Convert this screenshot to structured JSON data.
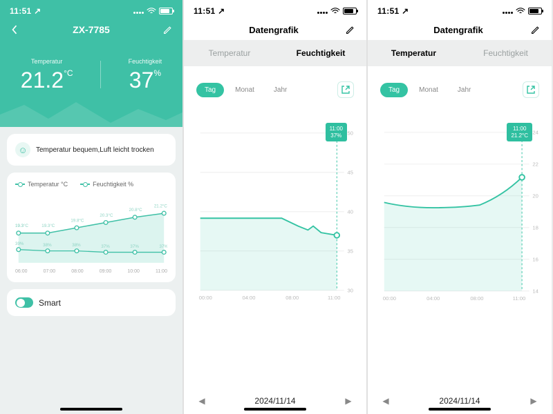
{
  "status": {
    "time": "11:51",
    "arrow": "↗"
  },
  "colors": {
    "accent": "#3fc0a6"
  },
  "screen1": {
    "title": "ZX-7785",
    "temp": {
      "label": "Temperatur",
      "value": "21.2",
      "unit": "°C"
    },
    "hum": {
      "label": "Feuchtigkeit",
      "value": "37",
      "unit": "%"
    },
    "comfort_text": "Temperatur bequem,Luft leicht trocken",
    "legend": {
      "temp": "Temperatur °C",
      "hum": "Feuchtigkeit %"
    },
    "smart_label": "Smart"
  },
  "screen2": {
    "header": "Datengrafik",
    "tab_temp": "Temperatur",
    "tab_hum": "Feuchtigkeit",
    "range": {
      "day": "Tag",
      "month": "Monat",
      "year": "Jahr"
    },
    "tooltip": {
      "time": "11:00",
      "value": "37%"
    },
    "date": "2024/11/14"
  },
  "screen3": {
    "header": "Datengrafik",
    "tab_temp": "Temperatur",
    "tab_hum": "Feuchtigkeit",
    "range": {
      "day": "Tag",
      "month": "Monat",
      "year": "Jahr"
    },
    "tooltip": {
      "time": "11:00",
      "value": "21.2°C"
    },
    "date": "2024/11/14"
  },
  "chart_data": [
    {
      "type": "line",
      "title": "Overview dual line",
      "categories": [
        "06:00",
        "07:00",
        "08:00",
        "09:00",
        "10:00",
        "11:00"
      ],
      "series": [
        {
          "name": "Temperatur °C",
          "values": [
            19.3,
            19.3,
            19.8,
            20.3,
            20.8,
            21.2
          ]
        },
        {
          "name": "Feuchtigkeit %",
          "values": [
            39,
            38,
            38,
            37,
            37,
            37
          ]
        }
      ]
    },
    {
      "type": "area",
      "title": "Feuchtigkeit Tag",
      "xlabel": "",
      "ylabel": "",
      "x": [
        "00:00",
        "04:00",
        "08:00",
        "11:00"
      ],
      "values": [
        39,
        39,
        38,
        37
      ],
      "ylim": [
        30,
        50
      ],
      "yticks": [
        30,
        35,
        40,
        45,
        50
      ]
    },
    {
      "type": "area",
      "title": "Temperatur Tag",
      "xlabel": "",
      "ylabel": "",
      "x": [
        "00:00",
        "04:00",
        "08:00",
        "11:00"
      ],
      "values": [
        19.6,
        19.3,
        19.4,
        21.2
      ],
      "ylim": [
        14,
        24
      ],
      "yticks": [
        14,
        16,
        18,
        20,
        22,
        24
      ]
    }
  ]
}
